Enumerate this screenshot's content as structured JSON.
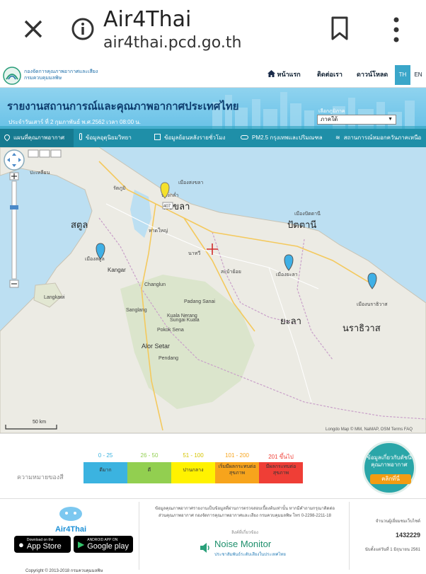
{
  "browser": {
    "title": "Air4Thai",
    "url": "air4thai.pcd.go.th"
  },
  "site": {
    "dept_line1": "กองจัดการคุณภาพอากาศและเสียง",
    "dept_line2": "กรมควบคุมมลพิษ",
    "nav": [
      {
        "label": "หน้าแรก"
      },
      {
        "label": "ติดต่อเรา"
      },
      {
        "label": "ดาวน์โหลด"
      }
    ],
    "lang_th": "TH",
    "lang_en": "EN",
    "banner_title": "รายงานสถานการณ์และคุณภาพอากาศประเทศไทย",
    "banner_sub": "ประจำวันเสาร์ ที่ 2 กุมภาพันธ์ พ.ศ.2562 เวลา 08:00 น.",
    "region_label": "เลือกภูมิภาค",
    "region_value": "ภาคใต้"
  },
  "tabs": [
    {
      "label": "แผนที่คุณภาพอากาศ",
      "active": true
    },
    {
      "label": "ข้อมูลอุตุนิยมวิทยา",
      "active": false
    },
    {
      "label": "ข้อมูลย้อนหลังรายชั่วโมง",
      "active": false
    },
    {
      "label": "PM2.5 กรุงเทพและปริมณฑล",
      "active": false
    },
    {
      "label": "สถานการณ์หมอกควันภาคเหนือ",
      "active": false
    }
  ],
  "map": {
    "places": [
      {
        "name": "สงขลา"
      },
      {
        "name": "สตูล"
      },
      {
        "name": "ปัตตานี"
      },
      {
        "name": "ยะลา"
      },
      {
        "name": "นราธิวาส"
      },
      {
        "name": "ปะเหลียน"
      },
      {
        "name": "บางกล่ำ"
      },
      {
        "name": "รัตภูมิ"
      },
      {
        "name": "หาดใหญ่"
      },
      {
        "name": "นาทวี"
      },
      {
        "name": "สะบ้าย้อย"
      },
      {
        "name": "Kangar"
      },
      {
        "name": "Alor Setar"
      },
      {
        "name": "Langkawi"
      },
      {
        "name": "Pokok Sena"
      },
      {
        "name": "Kuala Nerang"
      },
      {
        "name": "Padang Sanai"
      },
      {
        "name": "Changlun"
      },
      {
        "name": "Sanglang"
      },
      {
        "name": "Sungai Kuala"
      },
      {
        "name": "Pendang"
      },
      {
        "name": "เมืองสงขลา"
      },
      {
        "name": "เมืองปัตตานี"
      },
      {
        "name": "เมืองนราธิวาส"
      },
      {
        "name": "เมืองสตูล"
      },
      {
        "name": "เมืองยะลา"
      }
    ],
    "road_label": "407",
    "scale": "50 km",
    "attribution": "Longdo Map © MM, NaMAP, OSM Terms FAQ"
  },
  "legend": {
    "title": "ความหมายของสี",
    "levels": [
      {
        "range": "0 - 25",
        "label": "ดีมาก",
        "color": "#3bb3e0"
      },
      {
        "range": "26 - 50",
        "label": "ดี",
        "color": "#92cf50"
      },
      {
        "range": "51 - 100",
        "label": "ปานกลาง",
        "color": "#fff200"
      },
      {
        "range": "101 - 200",
        "label": "เริ่มมีผลกระทบต่อสุขภาพ",
        "color": "#f7a41c"
      },
      {
        "range": "201 ขึ้นไป",
        "label": "มีผลกระทบต่อสุขภาพ",
        "color": "#ef3e36"
      }
    ],
    "badge_text": "ข้อมูลเกี่ยวกับดัชนีคุณภาพอากาศ",
    "badge_button": "คลิกที่นี่"
  },
  "footer": {
    "app_name": "Air4Thai",
    "appstore_small": "Download on the",
    "appstore": "App Store",
    "gplay_small": "ANDROID APP ON",
    "gplay": "Google play",
    "info1": "ข้อมูลคุณภาพอากาศรายงานเป็นข้อมูลที่ผ่านการตรวจสอบเบื้องต้นเท่านั้น หากมีคำถามกรุณาติดต่อ",
    "info2": "ส่วนคุณภาพอากาศ กองจัดการคุณภาพอากาศและเสียง กรมควบคุมมลพิษ โทร 0-2298-2211-18",
    "related": "ลิงค์ที่เกี่ยวข้อง",
    "noise": "Noise Monitor",
    "noise_sub": "ประชาสัมพันธ์ระดับเสียงในประเทศไทย",
    "visitors_label": "จำนวนผู้เยี่ยมชมเว็บไซต์",
    "visitors": "1432229",
    "since": "นับตั้งแต่วันที่ 1 มิถุนายน 2561",
    "copyright": "Copyright © 2013-2018 กรมควบคุมมลพิษ"
  },
  "colors": {
    "teal": "#1f8fa8",
    "banner": "#7ccbea"
  }
}
